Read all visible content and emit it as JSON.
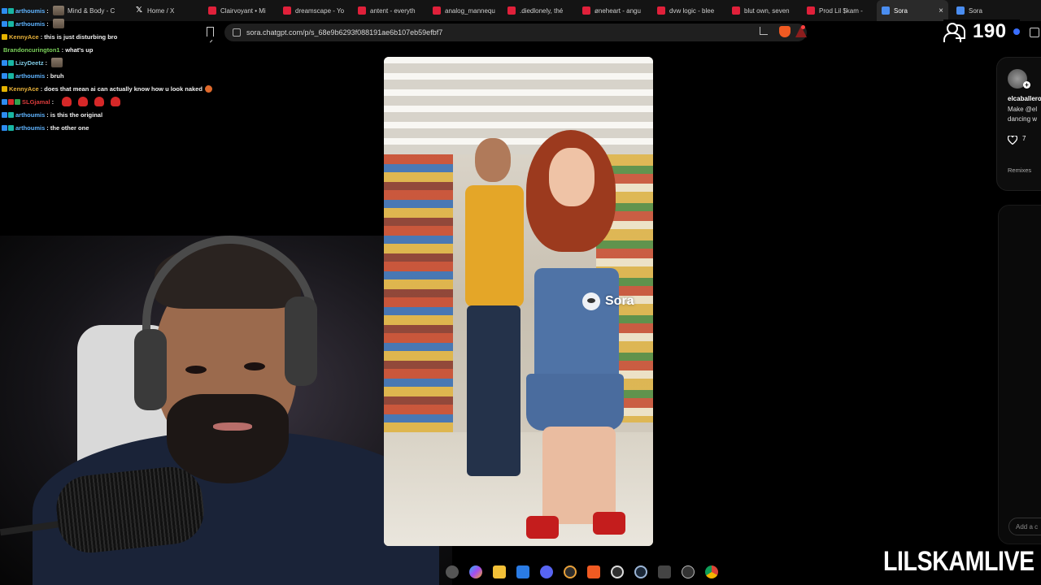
{
  "browser": {
    "tabs": [
      {
        "label": "Mind & Body - C",
        "icon": "thumbnail-icon"
      },
      {
        "label": "Home / X",
        "icon": "x-logo-icon"
      },
      {
        "label": "Clairvoyant • Mi",
        "icon": "youtube-icon"
      },
      {
        "label": "dreamscape - Yo",
        "icon": "youtube-icon"
      },
      {
        "label": "antent - everyth",
        "icon": "youtube-icon"
      },
      {
        "label": "analog_mannequ",
        "icon": "youtube-icon"
      },
      {
        "label": ".diedlonely, thé",
        "icon": "youtube-icon"
      },
      {
        "label": "øneheart - angu",
        "icon": "youtube-icon"
      },
      {
        "label": "dvw logic - blee",
        "icon": "youtube-icon"
      },
      {
        "label": "blut own, seven",
        "icon": "youtube-icon"
      },
      {
        "label": "Prod Lil $kam -",
        "icon": "youtube-icon"
      },
      {
        "label": "Sora",
        "icon": "sora-icon",
        "active": true,
        "close": "×"
      },
      {
        "label": "Sora",
        "icon": "sora-icon"
      }
    ],
    "url": "sora.chatgpt.com/p/s_68e9b6293f088191ae6b107eb59efbf7"
  },
  "stream": {
    "viewer_count": "190",
    "channel_name": "LILSKAMLIVE"
  },
  "chat": [
    {
      "user": "arthoumis",
      "user_color": "#5fb4ff",
      "text": "",
      "emote": "image"
    },
    {
      "user": "arthoumis",
      "user_color": "#5fb4ff",
      "text": "",
      "emote": "image"
    },
    {
      "user": "KennyAce",
      "user_color": "#e8b23a",
      "text": "this is just disturbing bro"
    },
    {
      "user": "Brandoncurington1",
      "user_color": "#7bd15a",
      "text": "what's up"
    },
    {
      "user": "LizyDeetz",
      "user_color": "#7ec8e3",
      "text": "",
      "emote": "image"
    },
    {
      "user": "arthoumis",
      "user_color": "#5fb4ff",
      "text": "bruh"
    },
    {
      "user": "KennyAce",
      "user_color": "#e8b23a",
      "text": "does that mean ai can actually know how u look naked",
      "emote": "small"
    },
    {
      "user": "SLGjamal",
      "user_color": "#d63a3a",
      "text": "",
      "emote": "red-multi"
    },
    {
      "user": "arthoumis",
      "user_color": "#5fb4ff",
      "text": "is this the original"
    },
    {
      "user": "arthoumis",
      "user_color": "#5fb4ff",
      "text": "the other one"
    }
  ],
  "video": {
    "watermark": "Sora"
  },
  "side_panel": {
    "username": "elcaballero",
    "caption": "Make @el\ndancing w",
    "likes": "7",
    "remixes_label": "Remixes",
    "comment_placeholder": "Add a c"
  },
  "colors": {
    "background": "#000000",
    "tabbar": "#141414",
    "youtube_red": "#e0203a",
    "accent_blue": "#3a6fff"
  }
}
